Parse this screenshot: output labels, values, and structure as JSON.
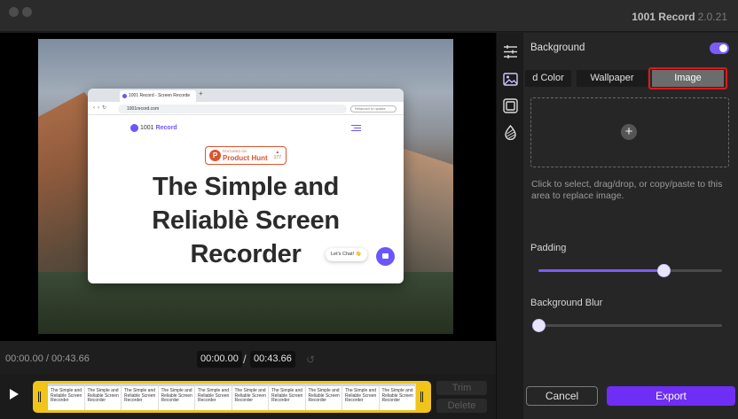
{
  "app": {
    "title": "1001 Record",
    "version": "2.0.21"
  },
  "preview": {
    "browser_tab": "1001 Record - Screen Recorde",
    "url": "1001record.com",
    "extension_text": "Relaunch to update",
    "logo_prefix": "1001",
    "logo_name": "Record",
    "ph_featured": "FEATURED ON",
    "ph_name": "Product Hunt",
    "ph_votes": "177",
    "headline_lines": [
      "The Simple and",
      "Reliablè Screen",
      "Recorder"
    ],
    "chat_label": "Let's Chat! 👋"
  },
  "playback": {
    "elapsed_total": "00:00.00 / 00:43.66",
    "current": "00:00.00",
    "separator": "/",
    "duration": "00:43.66"
  },
  "timeline": {
    "frames": [
      "The Simple and Reliable Screen Recorder",
      "The Simple and Reliable Screen Recorder",
      "The Simple and Reliable Screen Recorder",
      "The Simple and Reliable Screen Recorder",
      "The Simple and Reliable Screen Recorder",
      "The Simple and Reliable Screen Recorder",
      "The Simple and Reliable Screen Recorder",
      "The Simple and Reliable Screen Recorder",
      "The Simple and Reliable Screen Recorder",
      "The Simple and Reliable Screen Recorder"
    ],
    "trim_label": "Trim",
    "delete_label": "Delete"
  },
  "panel": {
    "background_label": "Background",
    "background_enabled": true,
    "segments": [
      "d Color",
      "Wallpaper",
      "Image"
    ],
    "active_segment": "Image",
    "drop_hint": "Click to select, drag/drop, or copy/paste to this area to replace image.",
    "padding_label": "Padding",
    "padding_value": 0.68,
    "blur_label": "Background Blur",
    "blur_value": 0.0,
    "cancel_label": "Cancel",
    "export_label": "Export"
  },
  "icons": {
    "tools": [
      "sliders-icon",
      "image-icon",
      "frame-icon",
      "shadow-icon"
    ],
    "add": "plus-icon"
  },
  "colors": {
    "accent": "#7b5cf5",
    "export": "#6f2ef5",
    "clip": "#f0c419",
    "highlight": "#e3161b"
  }
}
